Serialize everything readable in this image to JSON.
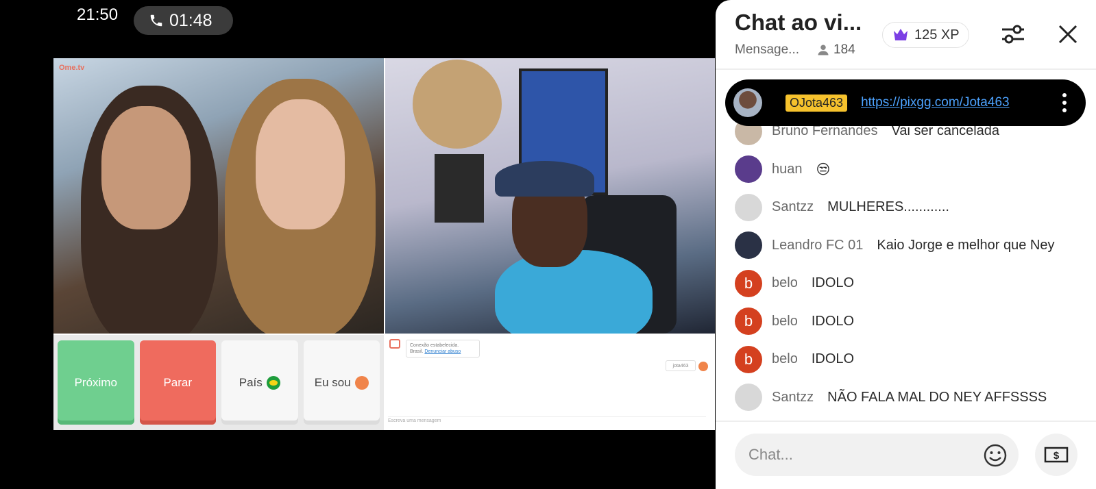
{
  "status": {
    "time": "21:50",
    "call_duration": "01:48"
  },
  "video": {
    "logo": "Ome.tv",
    "controls": {
      "next_label": "Próximo",
      "stop_label": "Parar",
      "country_label": "País",
      "iam_label": "Eu sou"
    },
    "chat": {
      "connection_text": "Conexão estabelecida.",
      "country_text": "Brasil.",
      "report_link": "Denunciar abuso",
      "user_chip": "jota463",
      "input_placeholder": "Escreva uma mensagem"
    }
  },
  "panel": {
    "title": "Chat ao vi...",
    "subtitle": "Mensage...",
    "viewer_count": "184",
    "xp": "125 XP",
    "pinned": {
      "name": "OJota463",
      "link": "https://pixgg.com/Jota463"
    },
    "messages": [
      {
        "user": "Bruno Fernandes",
        "text": "Vai ser cancelada",
        "avatar_color": "#c9b8a6",
        "avatar_letter": ""
      },
      {
        "user": "huan",
        "text": "😒",
        "avatar_color": "#5a3c8c",
        "avatar_letter": ""
      },
      {
        "user": "Santzz",
        "text": "MULHERES............",
        "avatar_color": "#d8d8d8",
        "avatar_letter": ""
      },
      {
        "user": "Leandro FC 01",
        "text": "Kaio Jorge e melhor que Ney",
        "avatar_color": "#2a3145",
        "avatar_letter": ""
      },
      {
        "user": "belo",
        "text": "IDOLO",
        "avatar_color": "#d4401f",
        "avatar_letter": "b"
      },
      {
        "user": "belo",
        "text": "IDOLO",
        "avatar_color": "#d4401f",
        "avatar_letter": "b"
      },
      {
        "user": "belo",
        "text": "IDOLO",
        "avatar_color": "#d4401f",
        "avatar_letter": "b"
      },
      {
        "user": "Santzz",
        "text": "NÃO FALA MAL DO NEY AFFSSSS",
        "avatar_color": "#d8d8d8",
        "avatar_letter": ""
      }
    ],
    "input_placeholder": "Chat..."
  },
  "colors": {
    "next": "#6fcf8f",
    "stop": "#ef6b5e",
    "pinned_name_bg": "#f6c22d",
    "link": "#4da3ff",
    "belo_avatar": "#d4401f"
  }
}
